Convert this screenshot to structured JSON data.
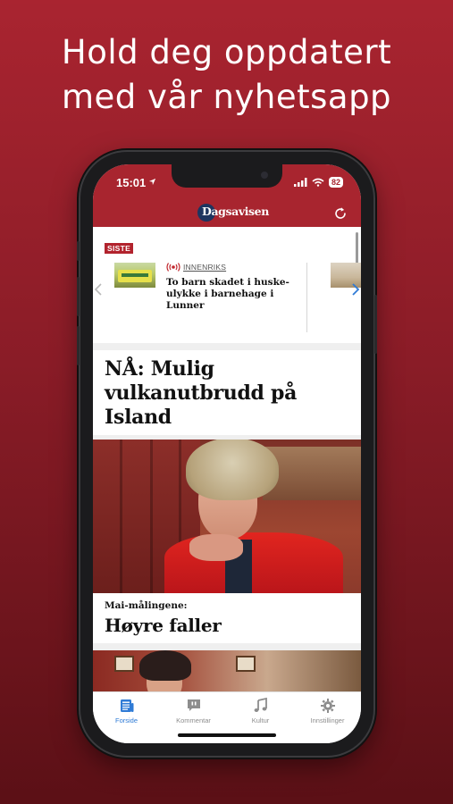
{
  "promo": {
    "line1": "Hold deg oppdatert",
    "line2": "med vår nyhetsapp"
  },
  "status_bar": {
    "time": "15:01",
    "battery": "82",
    "icons": [
      "location-arrow-icon",
      "signal-icon",
      "wifi-icon",
      "battery-icon"
    ]
  },
  "header": {
    "logo": "Dagsavisen",
    "refresh_icon": "refresh-icon",
    "brand_color": "#a8252f"
  },
  "siste": {
    "label": "SISTE",
    "items": [
      {
        "category": "INNENRIKS",
        "live_icon": "live-broadcast-icon",
        "title": "To barn skadet i huske-ulykke i barnehage i Lunner"
      }
    ]
  },
  "main_story": {
    "title": "NÅ: Mulig vulkanutbrudd på Island"
  },
  "second_story": {
    "kicker": "Mai-målingene:",
    "title": "Høyre faller"
  },
  "tabs": [
    {
      "label": "Forside",
      "icon": "newspaper-icon",
      "active": true
    },
    {
      "label": "Kommentar",
      "icon": "comment-icon",
      "active": false
    },
    {
      "label": "Kultur",
      "icon": "music-note-icon",
      "active": false
    },
    {
      "label": "Innstillinger",
      "icon": "gear-icon",
      "active": false
    }
  ],
  "colors": {
    "background": "#a92430",
    "active_tab": "#2f7bd6",
    "siste_tag": "#b2232d"
  }
}
